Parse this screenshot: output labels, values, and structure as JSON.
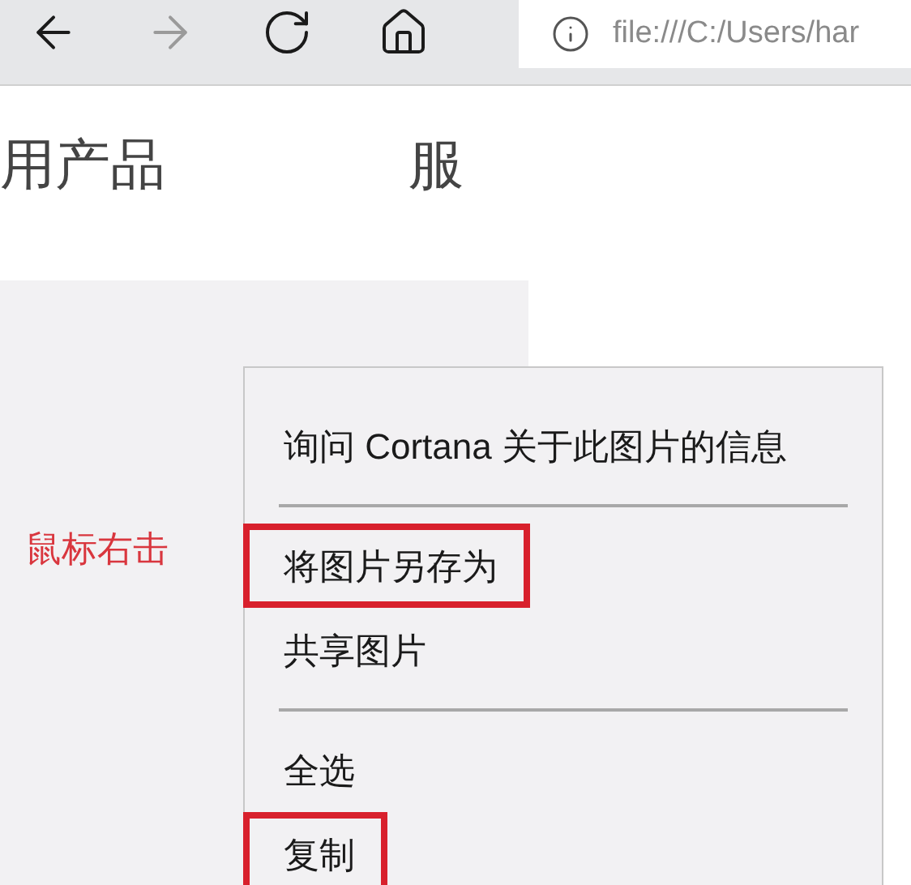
{
  "toolbar": {
    "buttons": [
      {
        "kind": "back",
        "disabled": false
      },
      {
        "kind": "forward",
        "disabled": true
      },
      {
        "kind": "refresh",
        "disabled": false
      },
      {
        "kind": "home",
        "disabled": false
      }
    ],
    "address": "file:///C:/Users/har"
  },
  "nav": [
    "用产品",
    "服"
  ],
  "annotation": "鼠标右击",
  "context_menu": [
    {
      "kind": "item",
      "label": "询问 Cortana 关于此图片的信息",
      "highlighted": false
    },
    {
      "kind": "separator"
    },
    {
      "kind": "item",
      "label": "将图片另存为",
      "highlighted": true
    },
    {
      "kind": "item",
      "label": "共享图片",
      "highlighted": false
    },
    {
      "kind": "separator"
    },
    {
      "kind": "item",
      "label": "全选",
      "highlighted": false
    },
    {
      "kind": "item",
      "label": "复制",
      "highlighted": true
    }
  ]
}
